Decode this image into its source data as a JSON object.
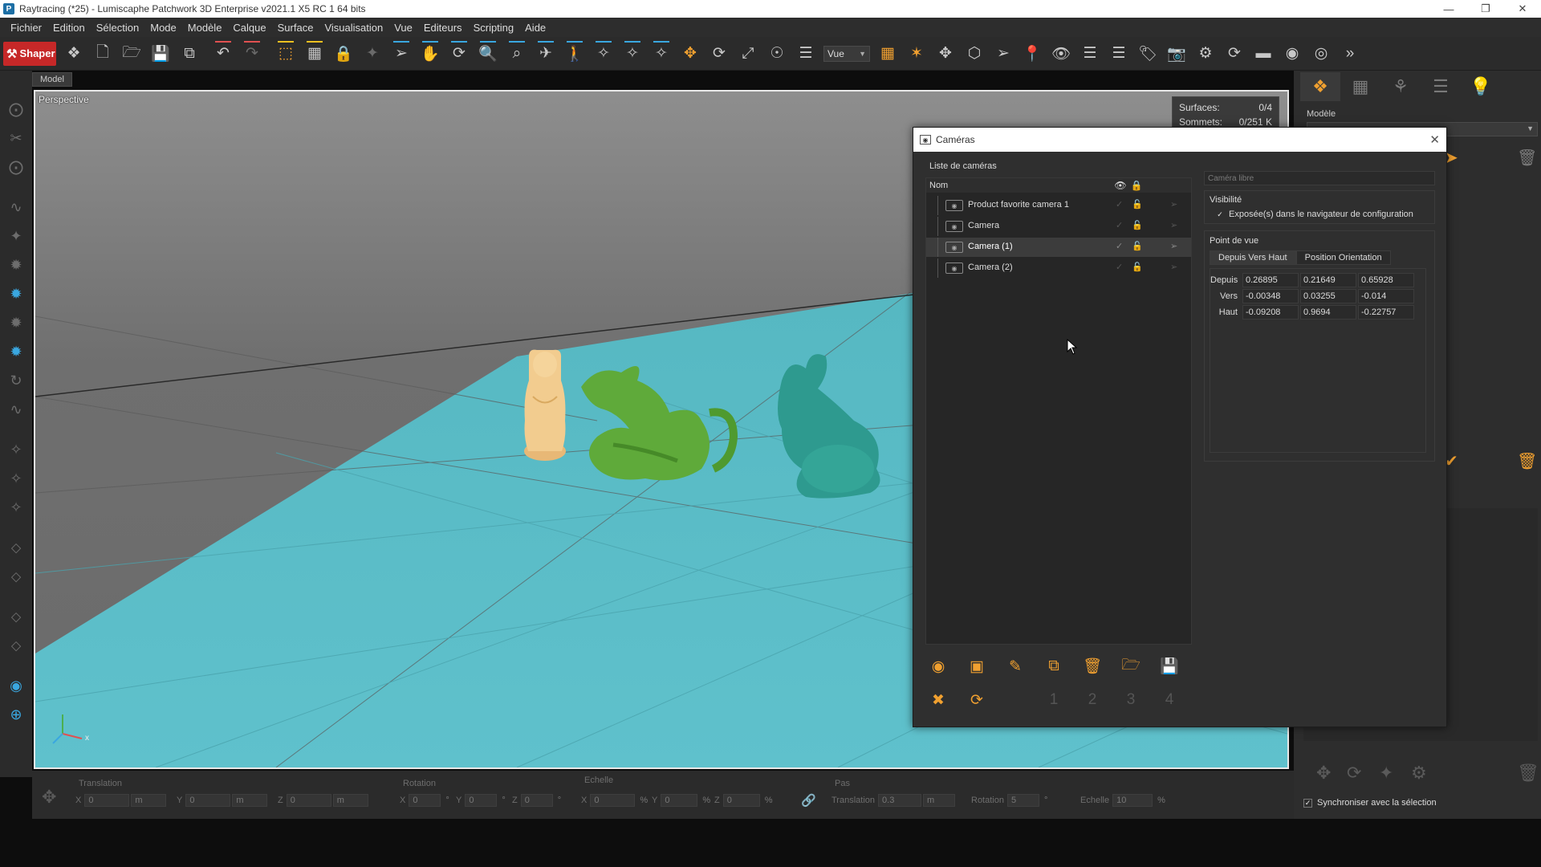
{
  "window": {
    "title": "Raytracing (*25) - Lumiscaphe Patchwork 3D Enterprise v2021.1 X5 RC 1 64 bits",
    "app_icon_letter": "P"
  },
  "menu": [
    "Fichier",
    "Edition",
    "Sélection",
    "Mode",
    "Modèle",
    "Calque",
    "Surface",
    "Visualisation",
    "Vue",
    "Editeurs",
    "Scripting",
    "Aide"
  ],
  "toolbar": {
    "shaper_label": "Shaper",
    "view_select_value": "Vue"
  },
  "viewport": {
    "tab_label": "Model",
    "projection_label": "Perspective",
    "stats": [
      {
        "label": "Surfaces:",
        "value": "0/4"
      },
      {
        "label": "Sommets:",
        "value": "0/251 K"
      }
    ],
    "axis_label": "x"
  },
  "right_panel": {
    "modele_label": "Modèle",
    "sync_label": "Synchroniser avec la sélection",
    "sync_checked": true
  },
  "bottom_bar": {
    "translation": {
      "label": "Translation",
      "x": "0",
      "y": "0",
      "z": "0",
      "unit": "m"
    },
    "rotation": {
      "label": "Rotation",
      "x": "0",
      "y": "0",
      "z": "0",
      "unit": "°"
    },
    "echelle": {
      "label": "Echelle",
      "x": "0",
      "y": "0",
      "z": "0",
      "unit": "%"
    },
    "pas": {
      "label": "Pas",
      "translation_label": "Translation",
      "translation_value": "0.3",
      "translation_unit": "m",
      "rotation_label": "Rotation",
      "rotation_value": "5",
      "rotation_unit": "°",
      "echelle_label": "Echelle",
      "echelle_value": "10",
      "echelle_unit": "%"
    },
    "axes": {
      "x": "X",
      "y": "Y",
      "z": "Z"
    }
  },
  "cameras_dialog": {
    "title": "Caméras",
    "list_label": "Liste de caméras",
    "column_name": "Nom",
    "cameras": [
      {
        "name": "Product favorite camera 1",
        "selected": false
      },
      {
        "name": "Camera",
        "selected": false
      },
      {
        "name": "Camera (1)",
        "selected": true
      },
      {
        "name": "Camera (2)",
        "selected": false
      }
    ],
    "free_camera_placeholder": "Caméra libre",
    "visibility": {
      "title": "Visibilité",
      "checkbox_label": "Exposée(s) dans le navigateur de configuration",
      "checked": true
    },
    "point_of_view": {
      "title": "Point de vue",
      "tab_active": "Depuis Vers Haut",
      "tab_inactive": "Position Orientation",
      "rows": [
        {
          "label": "Depuis",
          "values": [
            "0.26895",
            "0.21649",
            "0.65928"
          ]
        },
        {
          "label": "Vers",
          "values": [
            "-0.00348",
            "0.03255",
            "-0.014"
          ]
        },
        {
          "label": "Haut",
          "values": [
            "-0.09208",
            "0.9694",
            "-0.22757"
          ]
        }
      ]
    },
    "action_slot_labels": [
      "1",
      "2",
      "3",
      "4"
    ]
  },
  "colors": {
    "accent": "#f0a030",
    "shaper_red": "#c62828",
    "floor": "#5fc1cc",
    "buddha": "#f2cc8f",
    "dragon": "#5faa3a",
    "bunny": "#2e9a8f"
  }
}
